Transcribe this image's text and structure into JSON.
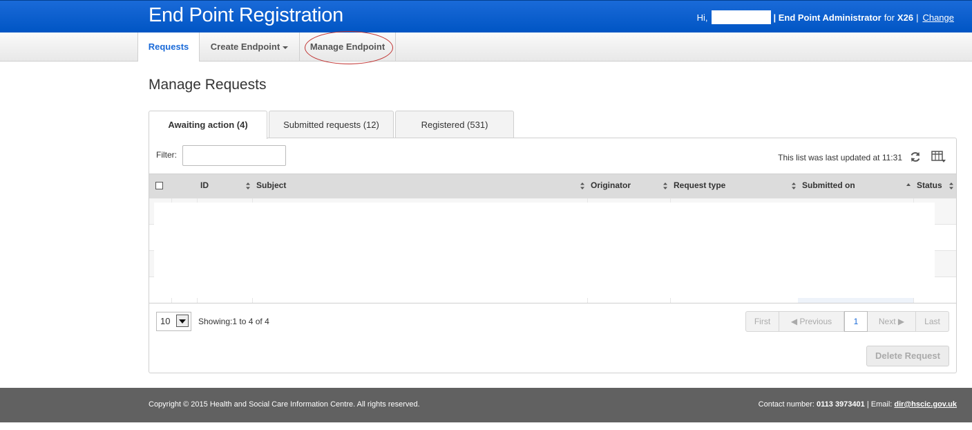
{
  "header": {
    "app_title": "End Point Registration",
    "greeting": "Hi,",
    "role": "| End Point Administrator",
    "for_label": "for",
    "org": "X26",
    "sep": "|",
    "change": "Change",
    "bg_color": "#0055c4"
  },
  "nav": {
    "items": [
      {
        "label": "Requests",
        "active": true
      },
      {
        "label": "Create Endpoint",
        "dropdown": true
      },
      {
        "label": "Manage Endpoint",
        "highlighted": true
      }
    ]
  },
  "page": {
    "title": "Manage Requests"
  },
  "tabs": [
    {
      "label": "Awaiting action (4)",
      "active": true
    },
    {
      "label": "Submitted requests (12)"
    },
    {
      "label": "Registered (531)"
    }
  ],
  "toolbar": {
    "filter_label": "Filter:",
    "filter_value": "",
    "updated_text": "This list was last updated at 11:31",
    "refresh_icon": "refresh-icon",
    "columns_icon": "column-chooser-icon"
  },
  "table": {
    "columns": [
      "ID",
      "Subject",
      "Originator",
      "Request type",
      "Submitted on",
      "Status"
    ],
    "sorted_column": "Submitted on",
    "sort_direction": "ascending",
    "row_count_visible": 4
  },
  "pagination": {
    "page_size": "10",
    "showing": "Showing:1 to 4 of 4",
    "first": "First",
    "previous": "◀  Previous",
    "current": "1",
    "next": "Next  ▶",
    "last": "Last"
  },
  "actions": {
    "delete": "Delete Request"
  },
  "footer": {
    "copyright": "Copyright © 2015 Health and Social Care Information Centre. All rights reserved.",
    "contact_label": "Contact number:",
    "phone": "0113 3973401",
    "email_label": "| Email:",
    "email": "dir@hscic.gov.uk",
    "bg_color": "#616161"
  }
}
